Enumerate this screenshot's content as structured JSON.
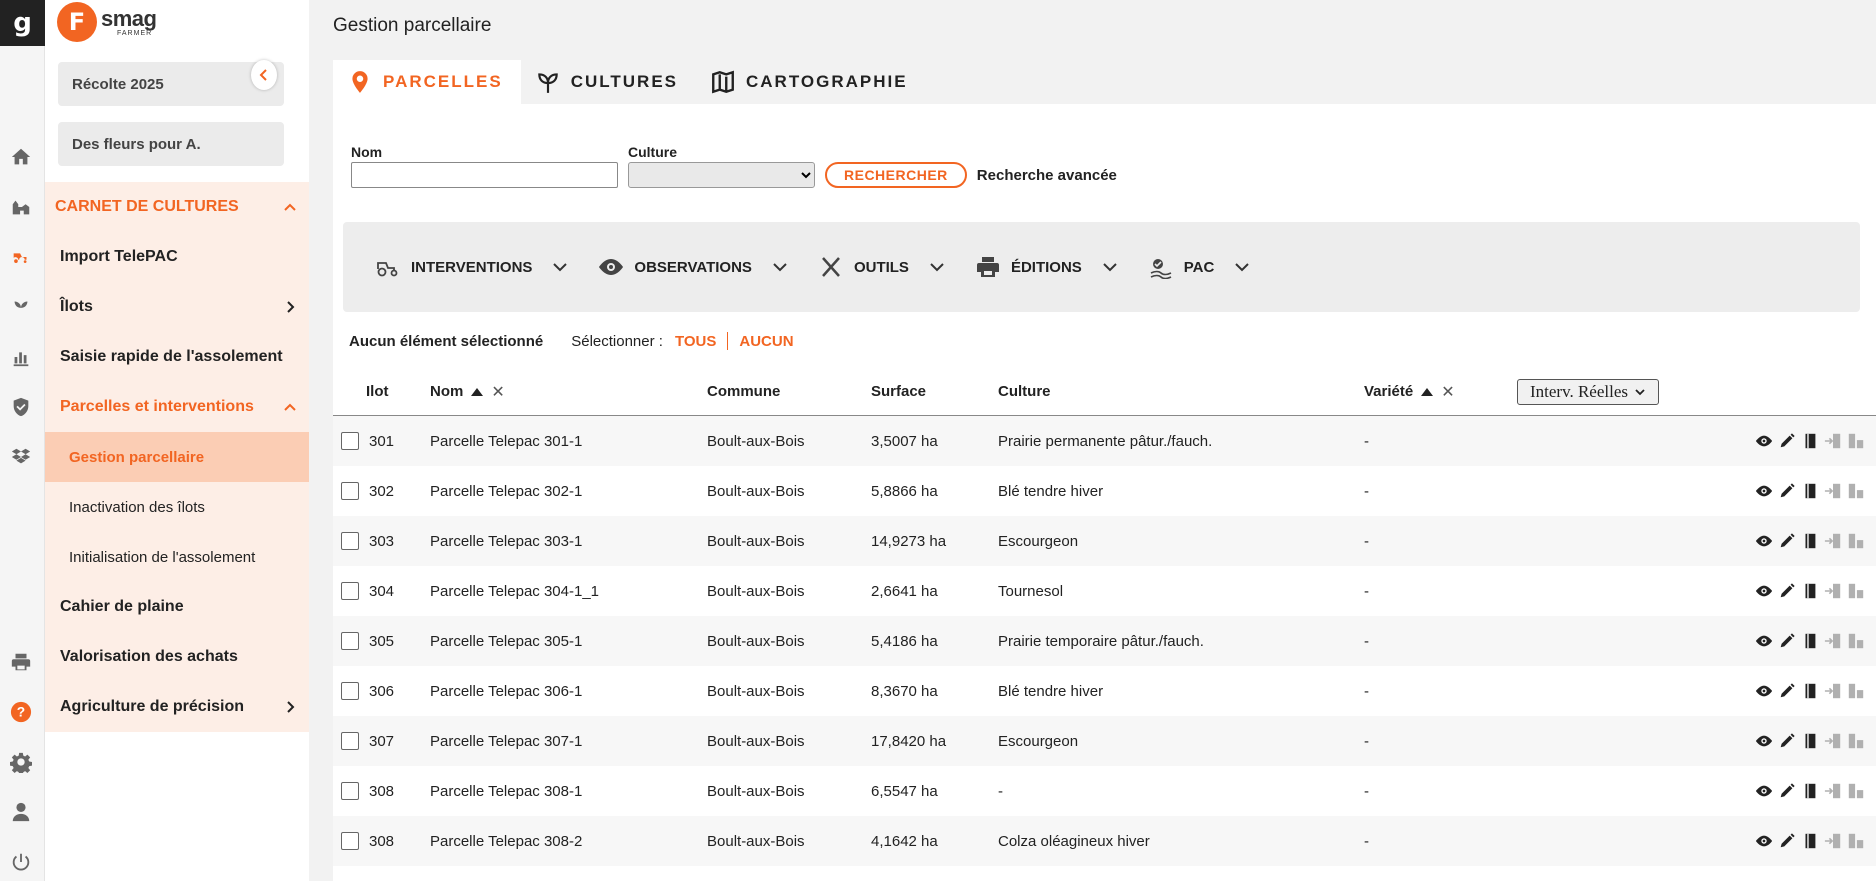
{
  "rail": {
    "logo": "g"
  },
  "brand": {
    "initial": "F",
    "name": "smag",
    "sub": "FARMER"
  },
  "sidebar": {
    "season": "Récolte 2025",
    "farm": "Des fleurs pour A.",
    "menu": [
      {
        "label": "CARNET DE CULTURES"
      },
      {
        "label": "Import TelePAC"
      },
      {
        "label": "Îlots"
      },
      {
        "label": "Saisie rapide de l'assolement"
      },
      {
        "label": "Parcelles et interventions"
      },
      {
        "label": "Gestion parcellaire"
      },
      {
        "label": "Inactivation des îlots"
      },
      {
        "label": "Initialisation de l'assolement"
      },
      {
        "label": "Cahier de plaine"
      },
      {
        "label": "Valorisation des achats"
      },
      {
        "label": "Agriculture de précision"
      }
    ]
  },
  "page": {
    "title": "Gestion parcellaire"
  },
  "tabs": [
    {
      "label": "PARCELLES"
    },
    {
      "label": "CULTURES"
    },
    {
      "label": "CARTOGRAPHIE"
    }
  ],
  "filters": {
    "nom_label": "Nom",
    "nom_value": "",
    "culture_label": "Culture",
    "culture_value": "",
    "search_button": "RECHERCHER",
    "advanced_link": "Recherche avancée"
  },
  "toolbar": [
    {
      "label": "INTERVENTIONS",
      "icon": "tractor-icon"
    },
    {
      "label": "OBSERVATIONS",
      "icon": "eye-icon"
    },
    {
      "label": "OUTILS",
      "icon": "tools-icon"
    },
    {
      "label": "ÉDITIONS",
      "icon": "printer-icon"
    },
    {
      "label": "PAC",
      "icon": "pac-icon"
    }
  ],
  "selection": {
    "status": "Aucun élément sélectionné",
    "select_label": "Sélectionner :",
    "all": "TOUS",
    "none": "AUCUN"
  },
  "table": {
    "headers": {
      "ilot": "Ilot",
      "nom": "Nom",
      "commune": "Commune",
      "surface": "Surface",
      "culture": "Culture",
      "variete": "Variété",
      "interv": "Interv. Réelles"
    },
    "rows": [
      {
        "ilot": "301",
        "nom": "Parcelle Telepac 301-1",
        "commune": "Boult-aux-Bois",
        "surface": "3,5007 ha",
        "culture": "Prairie permanente pâtur./fauch.",
        "variete": "-"
      },
      {
        "ilot": "302",
        "nom": "Parcelle Telepac 302-1",
        "commune": "Boult-aux-Bois",
        "surface": "5,8866 ha",
        "culture": "Blé tendre hiver",
        "variete": "-"
      },
      {
        "ilot": "303",
        "nom": "Parcelle Telepac 303-1",
        "commune": "Boult-aux-Bois",
        "surface": "14,9273 ha",
        "culture": "Escourgeon",
        "variete": "-"
      },
      {
        "ilot": "304",
        "nom": "Parcelle Telepac 304-1_1",
        "commune": "Boult-aux-Bois",
        "surface": "2,6641 ha",
        "culture": "Tournesol",
        "variete": "-"
      },
      {
        "ilot": "305",
        "nom": "Parcelle Telepac 305-1",
        "commune": "Boult-aux-Bois",
        "surface": "5,4186 ha",
        "culture": "Prairie temporaire pâtur./fauch.",
        "variete": "-"
      },
      {
        "ilot": "306",
        "nom": "Parcelle Telepac 306-1",
        "commune": "Boult-aux-Bois",
        "surface": "8,3670 ha",
        "culture": "Blé tendre hiver",
        "variete": "-"
      },
      {
        "ilot": "307",
        "nom": "Parcelle Telepac 307-1",
        "commune": "Boult-aux-Bois",
        "surface": "17,8420 ha",
        "culture": "Escourgeon",
        "variete": "-"
      },
      {
        "ilot": "308",
        "nom": "Parcelle Telepac 308-1",
        "commune": "Boult-aux-Bois",
        "surface": "6,5547 ha",
        "culture": "-",
        "variete": "-"
      },
      {
        "ilot": "308",
        "nom": "Parcelle Telepac 308-2",
        "commune": "Boult-aux-Bois",
        "surface": "4,1642 ha",
        "culture": "Colza oléagineux hiver",
        "variete": "-"
      }
    ]
  },
  "colors": {
    "accent": "#f26522",
    "menu_bg": "#fdeee6",
    "menu_selected": "#fbcdb4"
  }
}
